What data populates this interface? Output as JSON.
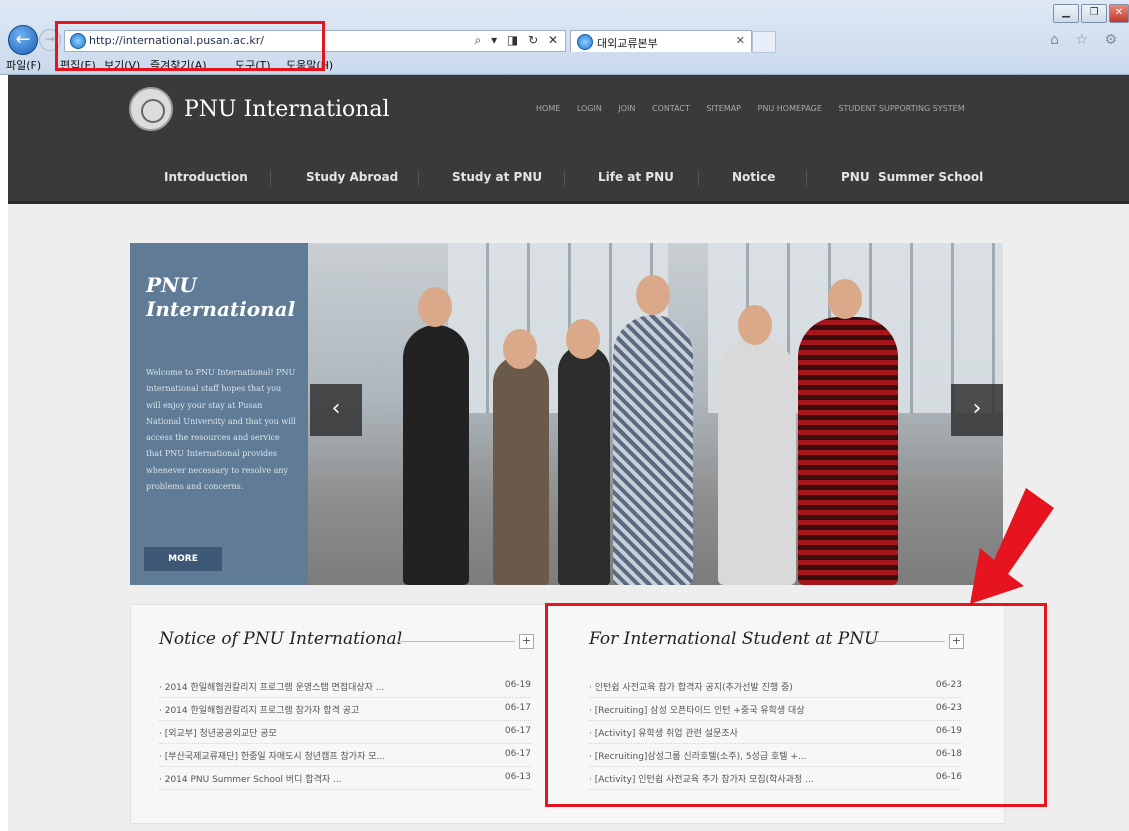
{
  "browser": {
    "url": "http://international.pusan.ac.kr/",
    "tab_title": "대외교류본부",
    "address_tools": "⌕ ▾ ◨ ↻ ✕",
    "menu": [
      "파일(F)",
      "편집(E)",
      "보기(V)",
      "즐겨찾기(A)",
      "도구(T)",
      "도움말(H)"
    ],
    "right_icons": "⌂ ☆ ⚙"
  },
  "site": {
    "brand": "PNU International",
    "util_links": [
      "HOME",
      "LOGIN",
      "JOIN",
      "CONTACT",
      "SITEMAP",
      "PNU HOMEPAGE",
      "STUDENT SUPPORTING SYSTEM"
    ],
    "nav": [
      "Introduction",
      "Study Abroad",
      "Study at PNU",
      "Life at PNU",
      "Notice",
      "PNU  Summer School"
    ]
  },
  "hero": {
    "title_line1": "PNU",
    "title_line2": "International",
    "body": "Welcome to PNU International! PNU international staff hopes that you will enjoy your stay at Pusan National University and that you will access the resources and service that PNU International provides whenever necessary to resolve any problems and concerns.",
    "more_label": "MORE",
    "prev": "‹",
    "next": "›"
  },
  "notices": {
    "left": {
      "title": "Notice of PNU International",
      "plus": "+",
      "items": [
        {
          "text": "· 2014 한일해협권칼리지 프로그램 운영스탭 면접대상자 ...",
          "date": "06-19"
        },
        {
          "text": "· 2014 한일해협권칼리지 프로그램 참가자 합격 공고",
          "date": "06-17"
        },
        {
          "text": "· [외교부] 청년공공외교단 공모",
          "date": "06-17"
        },
        {
          "text": "· [부산국제교류재단] 한중일 자매도시 청년캠프 참가자 모...",
          "date": "06-17"
        },
        {
          "text": "· 2014 PNU Summer School 버디 합격자 ...",
          "date": "06-13"
        }
      ]
    },
    "right": {
      "title": "For International Student at PNU",
      "plus": "+",
      "items": [
        {
          "text": "· 인턴쉽 사전교육 참가 합격자 공지(추가선발 진행 중)",
          "date": "06-23"
        },
        {
          "text": "· [Recruiting] 삼성 오픈타이드 인턴 +중국 유학생 대상",
          "date": "06-23"
        },
        {
          "text": "· [Activity] 유학생 취업 관련 설문조사",
          "date": "06-19"
        },
        {
          "text": "· [Recruiting]삼성그룹 신라호텔(소주), 5성급 호텔 +...",
          "date": "06-18"
        },
        {
          "text": "· [Activity] 인턴쉽 사전교육 추가 참가자 모집(학사과정 ...",
          "date": "06-16"
        }
      ]
    }
  },
  "colors": {
    "highlight": "#e5141f",
    "header": "#3a3a3a",
    "panel": "#5f7b95"
  }
}
